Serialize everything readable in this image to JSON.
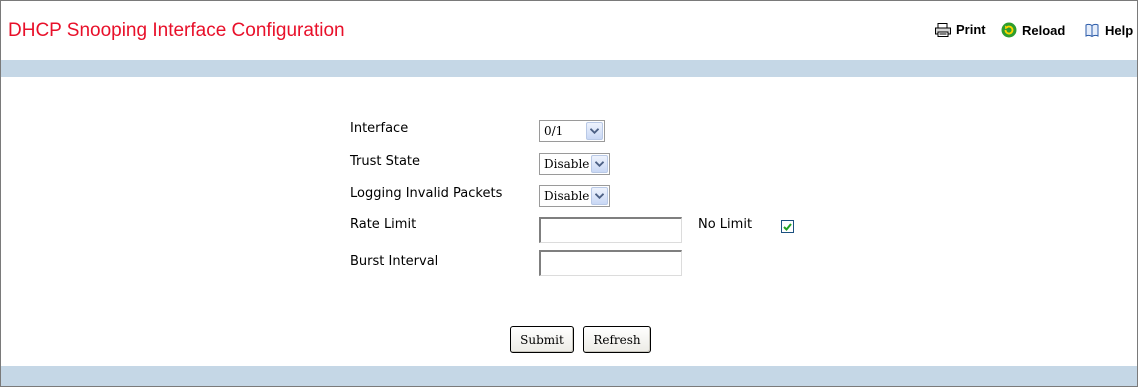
{
  "page": {
    "title": "DHCP Snooping Interface Configuration"
  },
  "toolbar": {
    "print_label": "Print",
    "reload_label": "Reload",
    "help_label": "Help"
  },
  "form": {
    "interface": {
      "label": "Interface",
      "value": "0/1"
    },
    "trust_state": {
      "label": "Trust State",
      "value": "Disable"
    },
    "logging_invalid_packets": {
      "label": "Logging Invalid Packets",
      "value": "Disable"
    },
    "rate_limit": {
      "label": "Rate Limit",
      "value": "",
      "no_limit_label": "No Limit",
      "no_limit_checked": true
    },
    "burst_interval": {
      "label": "Burst Interval",
      "value": ""
    }
  },
  "buttons": {
    "submit_label": "Submit",
    "refresh_label": "Refresh"
  },
  "colors": {
    "title": "#e8102a",
    "band": "#c5d7e6",
    "check": "#21a121"
  }
}
